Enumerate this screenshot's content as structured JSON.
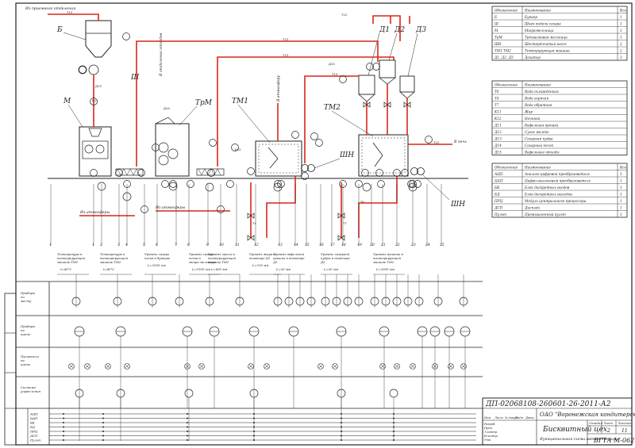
{
  "drawing": {
    "doc_code": "ДП-02068108-260601-26-2011-А2",
    "organization": "ОАО \"Воронежская кондитерская фабрика\"",
    "title": "Бисквитный цех",
    "subtitle": "Функциональная схема автоматизации",
    "school": "ВГТА М-062",
    "stage_header": "Стадия",
    "sheet_header": "Лист",
    "sheets_header": "Листов",
    "sheet_no": "2",
    "sheets_total": "11"
  },
  "equipment": [
    {
      "id": "B",
      "label": "Б"
    },
    {
      "id": "M",
      "label": "М"
    },
    {
      "id": "TrM",
      "label": "ТрМ"
    },
    {
      "id": "TM1",
      "label": "ТМ1"
    },
    {
      "id": "TM2",
      "label": "ТМ2"
    },
    {
      "id": "D1",
      "label": "Д1"
    },
    {
      "id": "D2",
      "label": "Д2"
    },
    {
      "id": "D3",
      "label": "Д3"
    },
    {
      "id": "Sh1",
      "label": "Ш"
    },
    {
      "id": "ShN1",
      "label": "ШН"
    },
    {
      "id": "ShN2",
      "label": "ШН"
    }
  ],
  "flow_notes": {
    "from_warehouse": "Из приемного отделения",
    "from_atm1": "Из атмосферы",
    "from_atm2": "Из атмосферы",
    "to_atm": "В атмосферу",
    "to_pack": "В печь",
    "outlet": "В отделение отходов"
  },
  "table1": {
    "h_code": "Обозначение",
    "h_name": "Наименование",
    "h_qty": "Кол",
    "rows": [
      {
        "code": "Б",
        "name": "Бункер",
        "qty": "1"
      },
      {
        "code": "Ш",
        "name": "Шнек подачи сахара",
        "qty": "1"
      },
      {
        "code": "М",
        "name": "Микромельница",
        "qty": "1"
      },
      {
        "code": "ТрМ",
        "name": "Трёхвалковая мельница",
        "qty": "1"
      },
      {
        "code": "ШН",
        "name": "Шестерёнчатый насос",
        "qty": "2"
      },
      {
        "code": "ТМ1 ТМ2",
        "name": "Темперирующая машина",
        "qty": "2"
      },
      {
        "code": "Д1, Д2, Д3",
        "name": "Дозатор",
        "qty": "3"
      }
    ]
  },
  "table2": {
    "h_code": "Обозначение",
    "h_name": "Наименование",
    "rows": [
      {
        "code": "Т0",
        "name": "Вода охлажденная"
      },
      {
        "code": "Т4",
        "name": "Вода горячая"
      },
      {
        "code": "Т7",
        "name": "Вода обратная"
      },
      {
        "code": "К11",
        "name": "Жир"
      },
      {
        "code": "К12",
        "name": "Начинка"
      },
      {
        "code": "Д11",
        "name": "Вафельная крошка"
      },
      {
        "code": "Д12",
        "name": "Сухое молоко"
      },
      {
        "code": "Д13",
        "name": "Сахарная пудра"
      },
      {
        "code": "Д14",
        "name": "Сахарный песок"
      },
      {
        "code": "Д15",
        "name": "Вафельные отходы"
      }
    ]
  },
  "table3": {
    "h_code": "Обозначение",
    "h_name": "Наименование",
    "h_qty": "Кол",
    "rows": [
      {
        "code": "АЦП",
        "name": "Аналого-цифровой преобразователь",
        "qty": "1"
      },
      {
        "code": "ЦАП",
        "name": "Цифро-аналоговый преобразователь",
        "qty": "1"
      },
      {
        "code": "БК",
        "name": "Блок дискретных входов",
        "qty": "1"
      },
      {
        "code": "БД",
        "name": "Блок дискретных выходов",
        "qty": "1"
      },
      {
        "code": "ПРЦ",
        "name": "Модуль центрального процессора",
        "qty": "1"
      },
      {
        "code": "ДСП",
        "name": "Дисплей",
        "qty": "1"
      },
      {
        "code": "Пульт",
        "name": "Промышленный пульт",
        "qty": "1"
      }
    ]
  },
  "loops": [
    {
      "text": "Температура в темперирующей машине ТМ1",
      "value": "t=45°С"
    },
    {
      "text": "Температура в темперирующей машине ТМ2",
      "value": "t=45°С"
    },
    {
      "text": "Уровень сахара песка в бункере",
      "value": "L=1500 мм"
    },
    {
      "text": "Уровень сахара песка в микро-мельнице",
      "value": "L=1500 мм"
    },
    {
      "text": "Уровень массы в темперирующей машине ТМ1",
      "value": "L=600 мм"
    },
    {
      "text": "Уровень жира в дозаторе Д1",
      "value": "L=150 мм"
    },
    {
      "text": "Уровень вафельной крошки в дозаторе Д2",
      "value": "L=50 мм"
    },
    {
      "text": "Уровень сахарной пудры в дозаторе Д3",
      "value": "L=50 мм"
    },
    {
      "text": "Уровень начинки в темперирующей машине ТМ2",
      "value": "L=2000 мм"
    }
  ],
  "side_rows": [
    "Приборы по месту",
    "Приборы на щите",
    "Пускатели на щите",
    "Система управ-ления"
  ],
  "bus_labels": [
    "АЦП",
    "ЦАП",
    "БК",
    "БД",
    "ПРЦ",
    "ДСП",
    "Пульт"
  ],
  "stamp_rows": [
    "Изм",
    "Лист",
    "№ докум.",
    "Подп.",
    "Дата",
    "Разраб.",
    "Пров.",
    "Т.контр.",
    "Н.контр.",
    "Утв."
  ],
  "pipe_labels": [
    "Т13",
    "Т13",
    "Т13",
    "Т13",
    "Т12",
    "Т12",
    "К11",
    "К12",
    "Д13",
    "Д14",
    "Д15",
    "Т4",
    "Т7",
    "Т0"
  ],
  "column_numbers": [
    "1",
    "1",
    "2",
    "3",
    "4",
    "5",
    "6",
    "7",
    "8",
    "9",
    "10",
    "11",
    "12",
    "13",
    "14",
    "15",
    "16",
    "17",
    "18",
    "19",
    "20",
    "21",
    "22",
    "23",
    "24",
    "25"
  ]
}
